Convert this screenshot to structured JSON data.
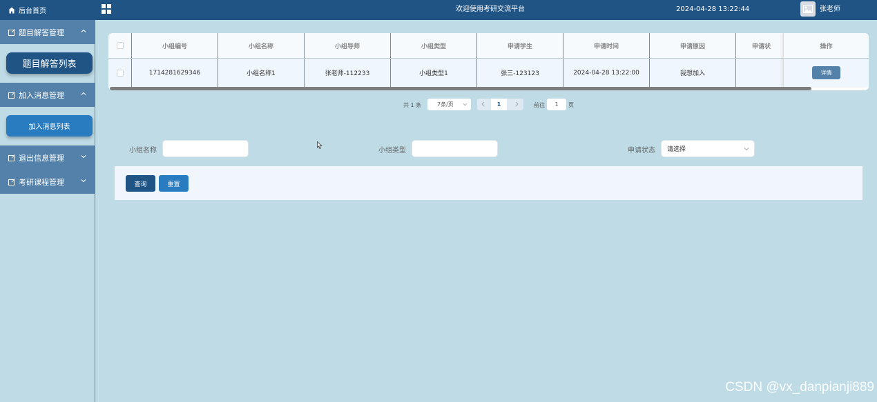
{
  "header": {
    "home_label": "后台首页",
    "site_title": "欢迎使用考研交流平台",
    "datetime": "2024-04-28 13:22:44",
    "username": "张老师"
  },
  "sidebar": {
    "groups": [
      {
        "label": "题目解答管理",
        "expanded": true,
        "sub": "题目解答列表"
      },
      {
        "label": "加入消息管理",
        "expanded": true,
        "sub": "加入消息列表"
      },
      {
        "label": "退出信息管理",
        "expanded": false
      },
      {
        "label": "考研课程管理",
        "expanded": false
      }
    ]
  },
  "table": {
    "columns": [
      "小组编号",
      "小组名称",
      "小组导师",
      "小组类型",
      "申请学生",
      "申请时间",
      "申请原因",
      "申请状"
    ],
    "action_header": "操作",
    "rows": [
      {
        "cells": [
          "1714281629346",
          "小组名称1",
          "张老师-112233",
          "小组类型1",
          "张三-123123",
          "2024-04-28 13:22:00",
          "我想加入",
          ""
        ],
        "action": "详情"
      }
    ]
  },
  "pagination": {
    "total_text": "共 1 条",
    "page_size": "7条/页",
    "current_page": "1",
    "goto_label": "前往",
    "goto_value": "1",
    "page_suffix": "页"
  },
  "search": {
    "group_name_label": "小组名称",
    "group_type_label": "小组类型",
    "status_label": "申请状态",
    "status_placeholder": "请选择",
    "query_button": "查询",
    "reset_button": "重置"
  },
  "watermark": "CSDN @vx_danpianji889",
  "colors": {
    "primary": "#1f5484",
    "menu": "#5381a9",
    "accent": "#2a7cc1",
    "background": "#bedbe6"
  }
}
